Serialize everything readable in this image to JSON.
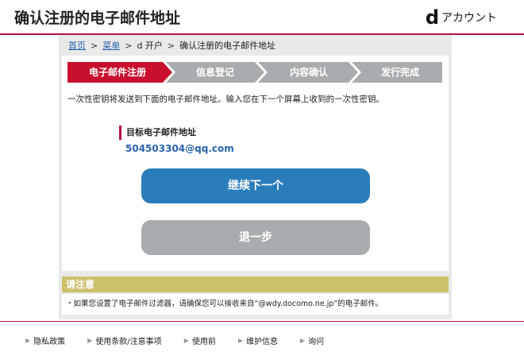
{
  "header": {
    "title": "确认注册的电子邮件地址",
    "brand_d": "d",
    "brand_text": "アカウント"
  },
  "breadcrumb": {
    "home": "首页",
    "menu": "菜单",
    "current_section": "d 开户",
    "current_page": "确认注册的电子邮件地址"
  },
  "steps": [
    {
      "label": "电子邮件注册",
      "active": true
    },
    {
      "label": "信息登记",
      "active": false
    },
    {
      "label": "内容确认",
      "active": false
    },
    {
      "label": "发行完成",
      "active": false
    }
  ],
  "instruction": "一次性密钥将发送到下面的电子邮件地址。输入您在下一个屏幕上收到的一次性密钥。",
  "email": {
    "label": "目标电子邮件地址",
    "value": "504503304@qq.com"
  },
  "buttons": {
    "next": "继续下一个",
    "back": "退一步"
  },
  "notice": {
    "title": "请注意",
    "text": "・如果您设置了电子邮件过滤器，请确保您可以接收来自“@wdy.docomo.ne.jp”的电子邮件。"
  },
  "footer": {
    "links": [
      "隐私政策",
      "使用条款/注意事项",
      "使用前",
      "维护信息",
      "询问"
    ]
  },
  "colors": {
    "accent": "#b5123e",
    "step_active": "#c8102e",
    "step_inactive": "#a9acae",
    "primary_button": "#2b7cba",
    "secondary_button": "#a9acae",
    "notice": "#cdc16a",
    "link": "#2a62b0"
  }
}
